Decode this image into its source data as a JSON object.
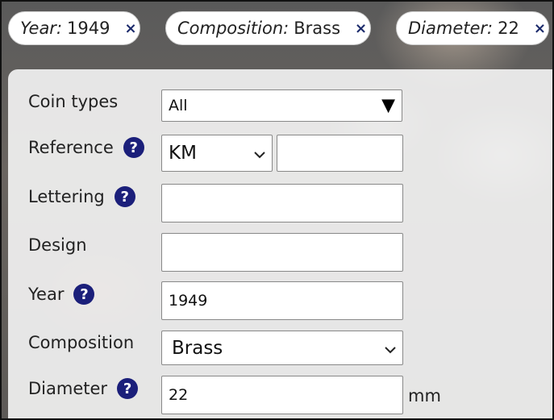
{
  "chips": [
    {
      "key": "Year:",
      "value": "1949",
      "close": "×"
    },
    {
      "key": "Composition:",
      "value": "Brass",
      "close": "×"
    },
    {
      "key": "Diameter:",
      "value": "22",
      "close": "×"
    }
  ],
  "form": {
    "coin_types": {
      "label": "Coin types",
      "value": "All",
      "arrow": "▼"
    },
    "reference": {
      "label": "Reference",
      "help": "?",
      "select_value": "KM",
      "input_value": ""
    },
    "lettering": {
      "label": "Lettering",
      "help": "?",
      "value": ""
    },
    "design": {
      "label": "Design",
      "value": ""
    },
    "year": {
      "label": "Year",
      "help": "?",
      "value": "1949"
    },
    "composition": {
      "label": "Composition",
      "value": "Brass"
    },
    "diameter": {
      "label": "Diameter",
      "help": "?",
      "value": "22",
      "unit": "mm"
    }
  }
}
